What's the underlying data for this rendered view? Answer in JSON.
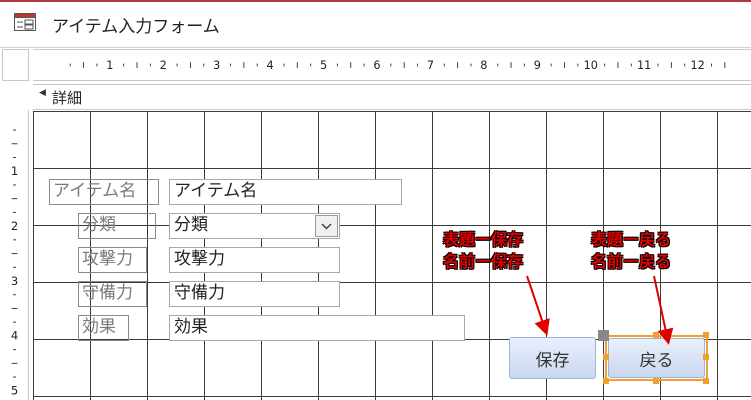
{
  "window": {
    "title": "アイテム入力フォーム"
  },
  "ruler": {
    "horizontal": [
      "1",
      "2",
      "3",
      "4",
      "5",
      "6",
      "7",
      "8",
      "9",
      "10",
      "11",
      "12"
    ],
    "vertical": [
      "1",
      "2",
      "3",
      "4",
      "5"
    ]
  },
  "section": {
    "label": "詳細"
  },
  "form": {
    "fields": [
      {
        "label": "アイテム名",
        "value": "アイテム名"
      },
      {
        "label": "分類",
        "value": "分類"
      },
      {
        "label": "攻撃力",
        "value": "攻撃力"
      },
      {
        "label": "守備力",
        "value": "守備力"
      },
      {
        "label": "効果",
        "value": "効果"
      }
    ],
    "buttons": {
      "save": "保存",
      "back": "戻る"
    }
  },
  "annotations": [
    {
      "line1": "表題ー保存",
      "line2": "名前ー保存"
    },
    {
      "line1": "表題ー戻る",
      "line2": "名前ー戻る"
    }
  ],
  "colors": {
    "annotation": "#e00000",
    "selection": "#f0a030",
    "titlebar_accent": "#b03a3a"
  }
}
